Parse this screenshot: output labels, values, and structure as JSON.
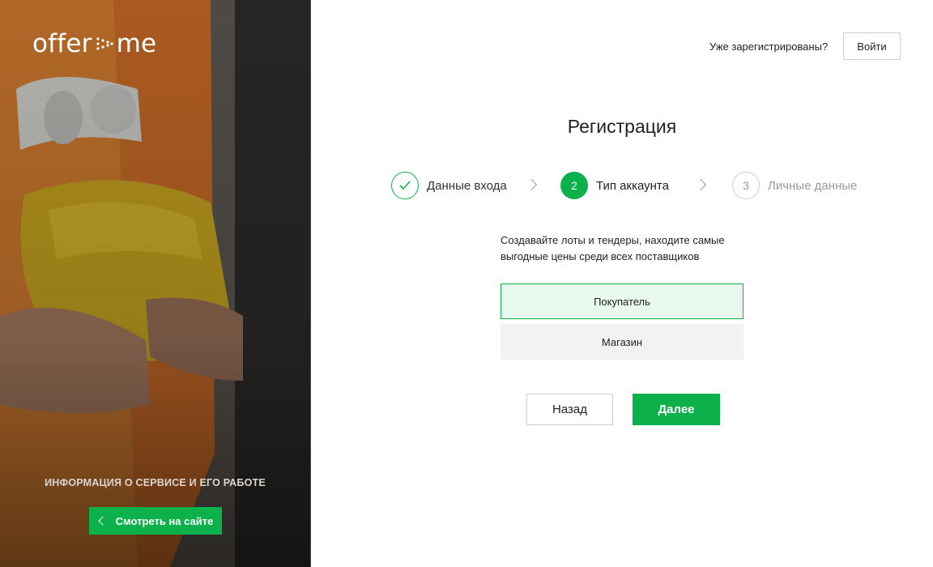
{
  "brand": {
    "logo_left": "offer",
    "logo_right": "me",
    "accent": "#0db14b"
  },
  "sidebar": {
    "info_title": "ИНФОРМАЦИЯ О СЕРВИСЕ И ЕГО РАБОТЕ",
    "site_button": "Смотреть на сайте"
  },
  "header": {
    "already_registered": "Уже зарегистрированы?",
    "login_button": "Войти"
  },
  "page_title": "Регистрация",
  "steps": [
    {
      "number": "",
      "label": "Данные входа",
      "state": "done",
      "icon": "check-icon"
    },
    {
      "number": "2",
      "label": "Тип аккаунта",
      "state": "active"
    },
    {
      "number": "3",
      "label": "Личные данные",
      "state": "pending"
    }
  ],
  "description": "Создавайте лоты и тендеры, находите самые выгодные цены среди всех поставщиков",
  "account_types": [
    {
      "label": "Покупатель",
      "selected": true
    },
    {
      "label": "Магазин",
      "selected": false
    }
  ],
  "actions": {
    "back": "Назад",
    "next": "Далее"
  }
}
